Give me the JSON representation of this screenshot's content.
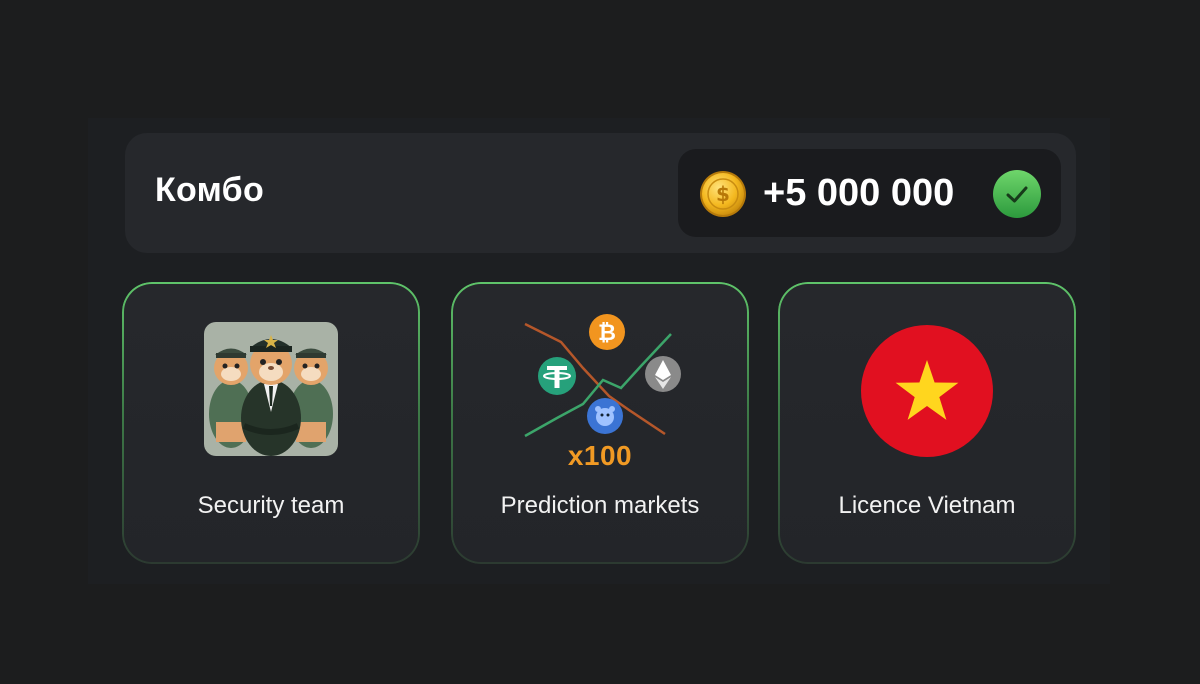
{
  "combo": {
    "title": "Комбо",
    "reward_amount": "+5 000 000",
    "coin_icon": "gold-dollar-coin-icon",
    "status_icon": "green-check-icon",
    "accent_color": "#5fc46a"
  },
  "cards": [
    {
      "label": "Security team",
      "icon": "hamster-security-team-image"
    },
    {
      "label": "Prediction markets",
      "icon": "crypto-prediction-chart-image",
      "badge": "x100"
    },
    {
      "label": "Licence Vietnam",
      "icon": "vietnam-flag-icon"
    }
  ]
}
